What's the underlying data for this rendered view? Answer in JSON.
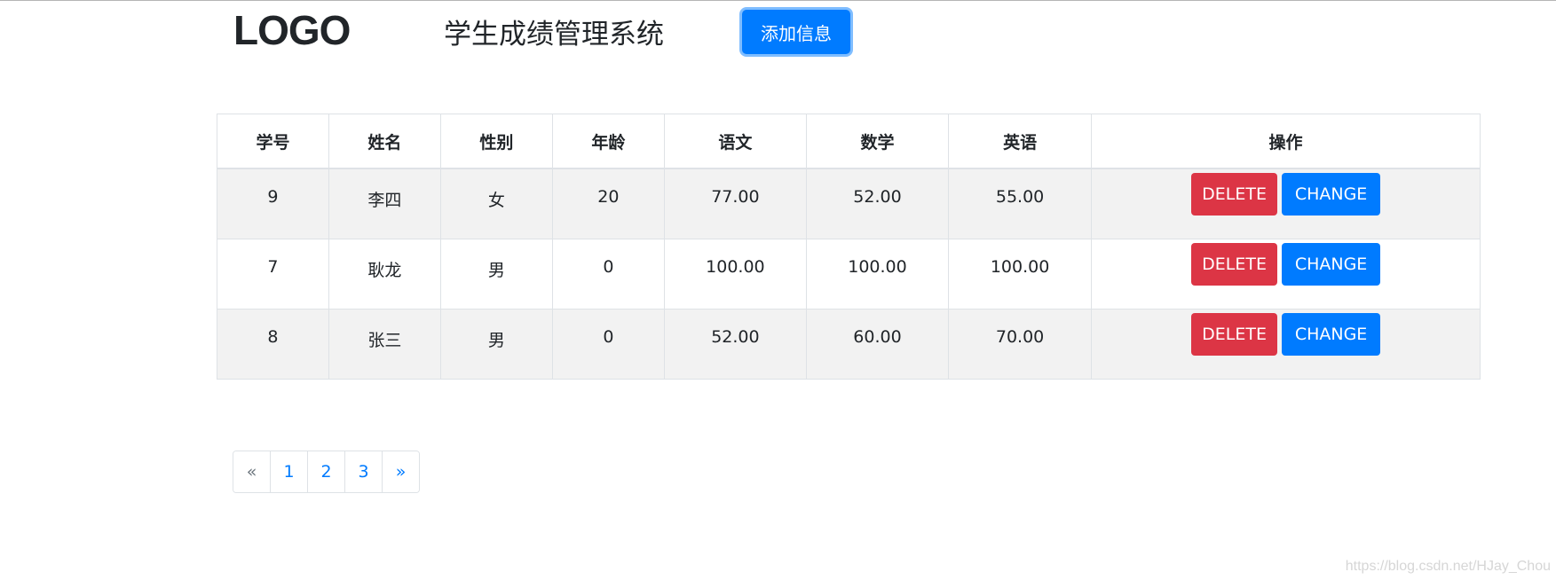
{
  "header": {
    "logo": "LOGO",
    "title": "学生成绩管理系统",
    "add_button": "添加信息"
  },
  "table": {
    "columns": [
      "学号",
      "姓名",
      "性别",
      "年龄",
      "语文",
      "数学",
      "英语",
      "操作"
    ],
    "rows": [
      {
        "id": "9",
        "name": "李四",
        "gender": "女",
        "age": "20",
        "chinese": "77.00",
        "math": "52.00",
        "english": "55.00"
      },
      {
        "id": "7",
        "name": "耿龙",
        "gender": "男",
        "age": "0",
        "chinese": "100.00",
        "math": "100.00",
        "english": "100.00"
      },
      {
        "id": "8",
        "name": "张三",
        "gender": "男",
        "age": "0",
        "chinese": "52.00",
        "math": "60.00",
        "english": "70.00"
      }
    ],
    "delete_label": "DELETE",
    "change_label": "CHANGE"
  },
  "pagination": {
    "prev": "«",
    "pages": [
      "1",
      "2",
      "3"
    ],
    "next": "»"
  },
  "watermark": "https://blog.csdn.net/HJay_Chou",
  "colors": {
    "primary": "#007bff",
    "danger": "#dc3545",
    "stripe": "#f2f2f2"
  }
}
